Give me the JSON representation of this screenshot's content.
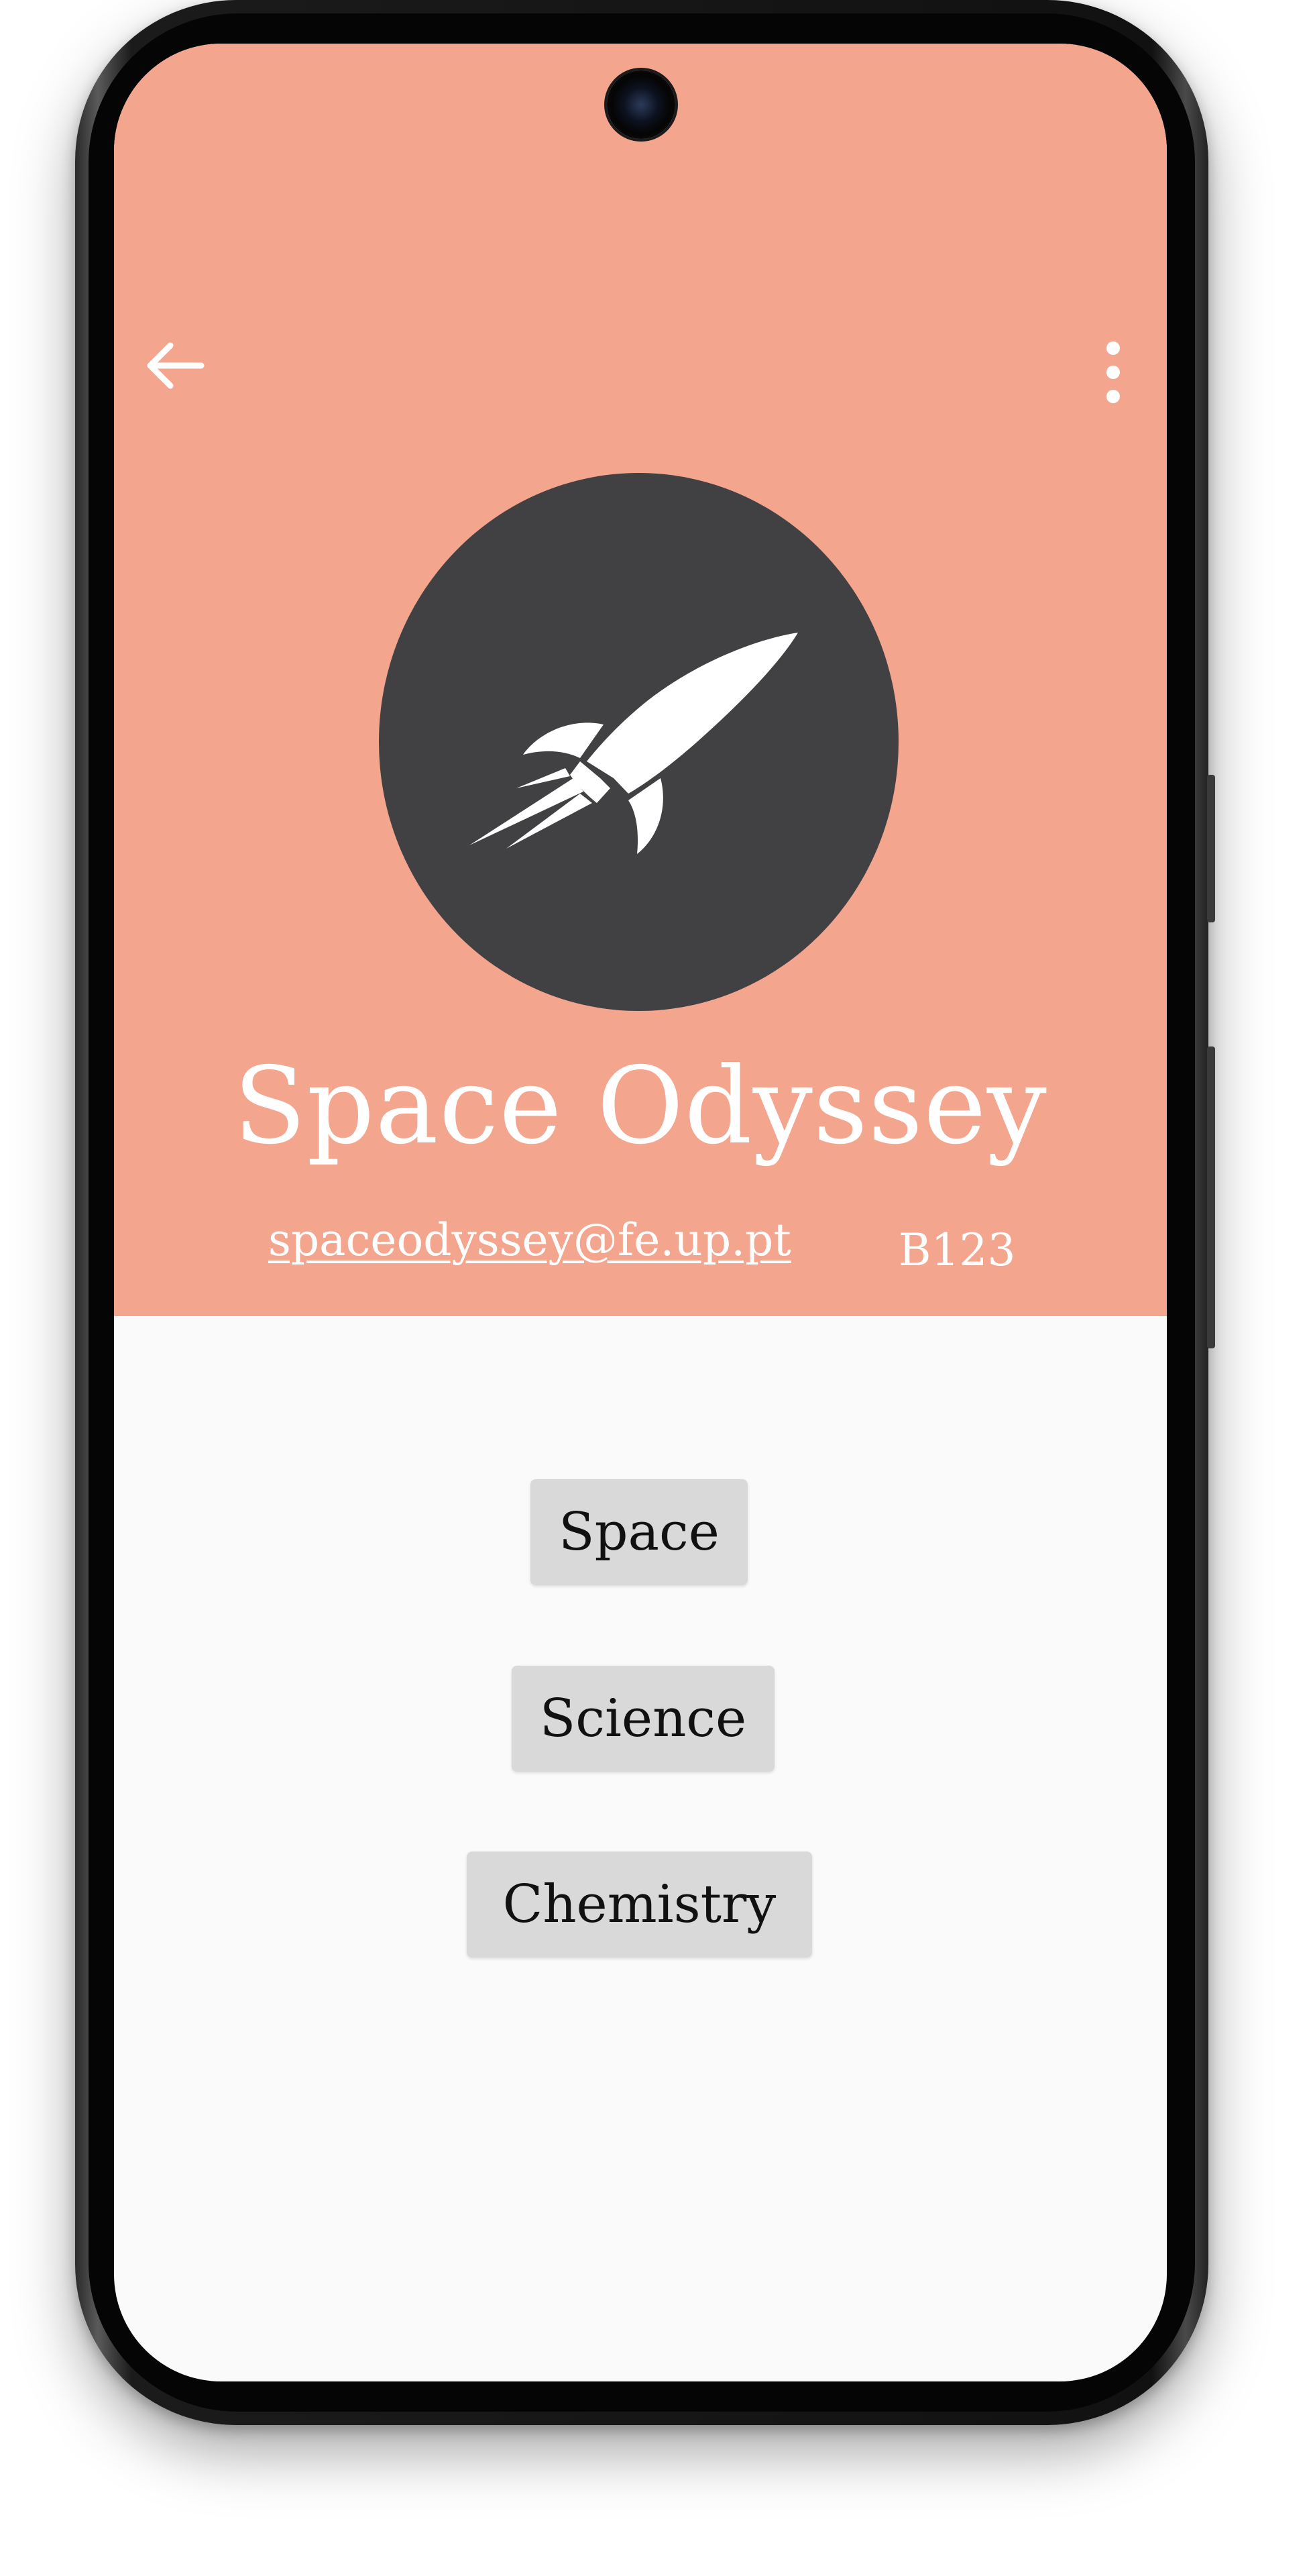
{
  "header": {
    "back_icon": "arrow-left-icon",
    "more_icon": "more-vertical-icon",
    "background_color": "#f3a58e"
  },
  "profile": {
    "logo_icon": "rocket-icon",
    "title": "Space Odyssey",
    "email": "spaceodyssey@fe.up.pt",
    "room": "B123"
  },
  "tags": [
    {
      "label": "Space"
    },
    {
      "label": "Science"
    },
    {
      "label": "Chemistry"
    }
  ]
}
